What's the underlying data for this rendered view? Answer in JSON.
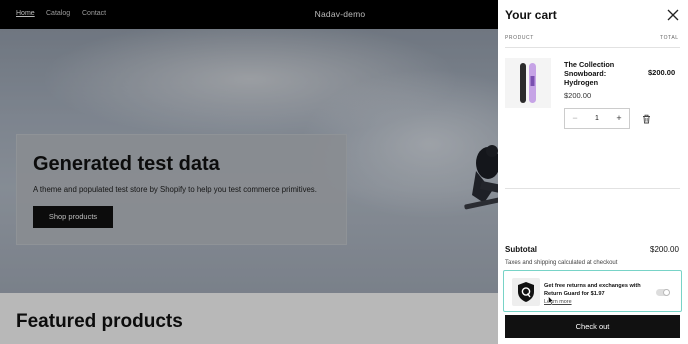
{
  "nav": {
    "links": [
      {
        "label": "Home",
        "active": true
      },
      {
        "label": "Catalog",
        "active": false
      },
      {
        "label": "Contact",
        "active": false
      }
    ],
    "store_name": "Nadav-demo"
  },
  "hero": {
    "heading": "Generated test data",
    "subheading": "A theme and populated test store by Shopify to help you test commerce primitives.",
    "button_label": "Shop products"
  },
  "featured": {
    "heading": "Featured products"
  },
  "cart": {
    "title": "Your cart",
    "columns": {
      "product": "PRODUCT",
      "total": "TOTAL"
    },
    "item": {
      "name": "The Collection Snowboard: Hydrogen",
      "price": "$200.00",
      "line_total": "$200.00",
      "quantity": "1",
      "minus": "−",
      "plus": "+"
    },
    "subtotal_label": "Subtotal",
    "subtotal_value": "$200.00",
    "tax_note": "Taxes and shipping calculated at checkout",
    "return_guard": {
      "text": "Get free returns and exchanges with Return Guard for $1.97",
      "learn_more": "Learn more",
      "toggle_on": false
    },
    "checkout_label": "Check out"
  },
  "colors": {
    "accent_border": "#78d3c7",
    "button_bg": "#111111",
    "nav_bg": "#000000"
  },
  "icons": {
    "close": "close-icon",
    "trash": "trash-icon",
    "shield": "shield-icon",
    "cursor": "cursor-icon"
  }
}
